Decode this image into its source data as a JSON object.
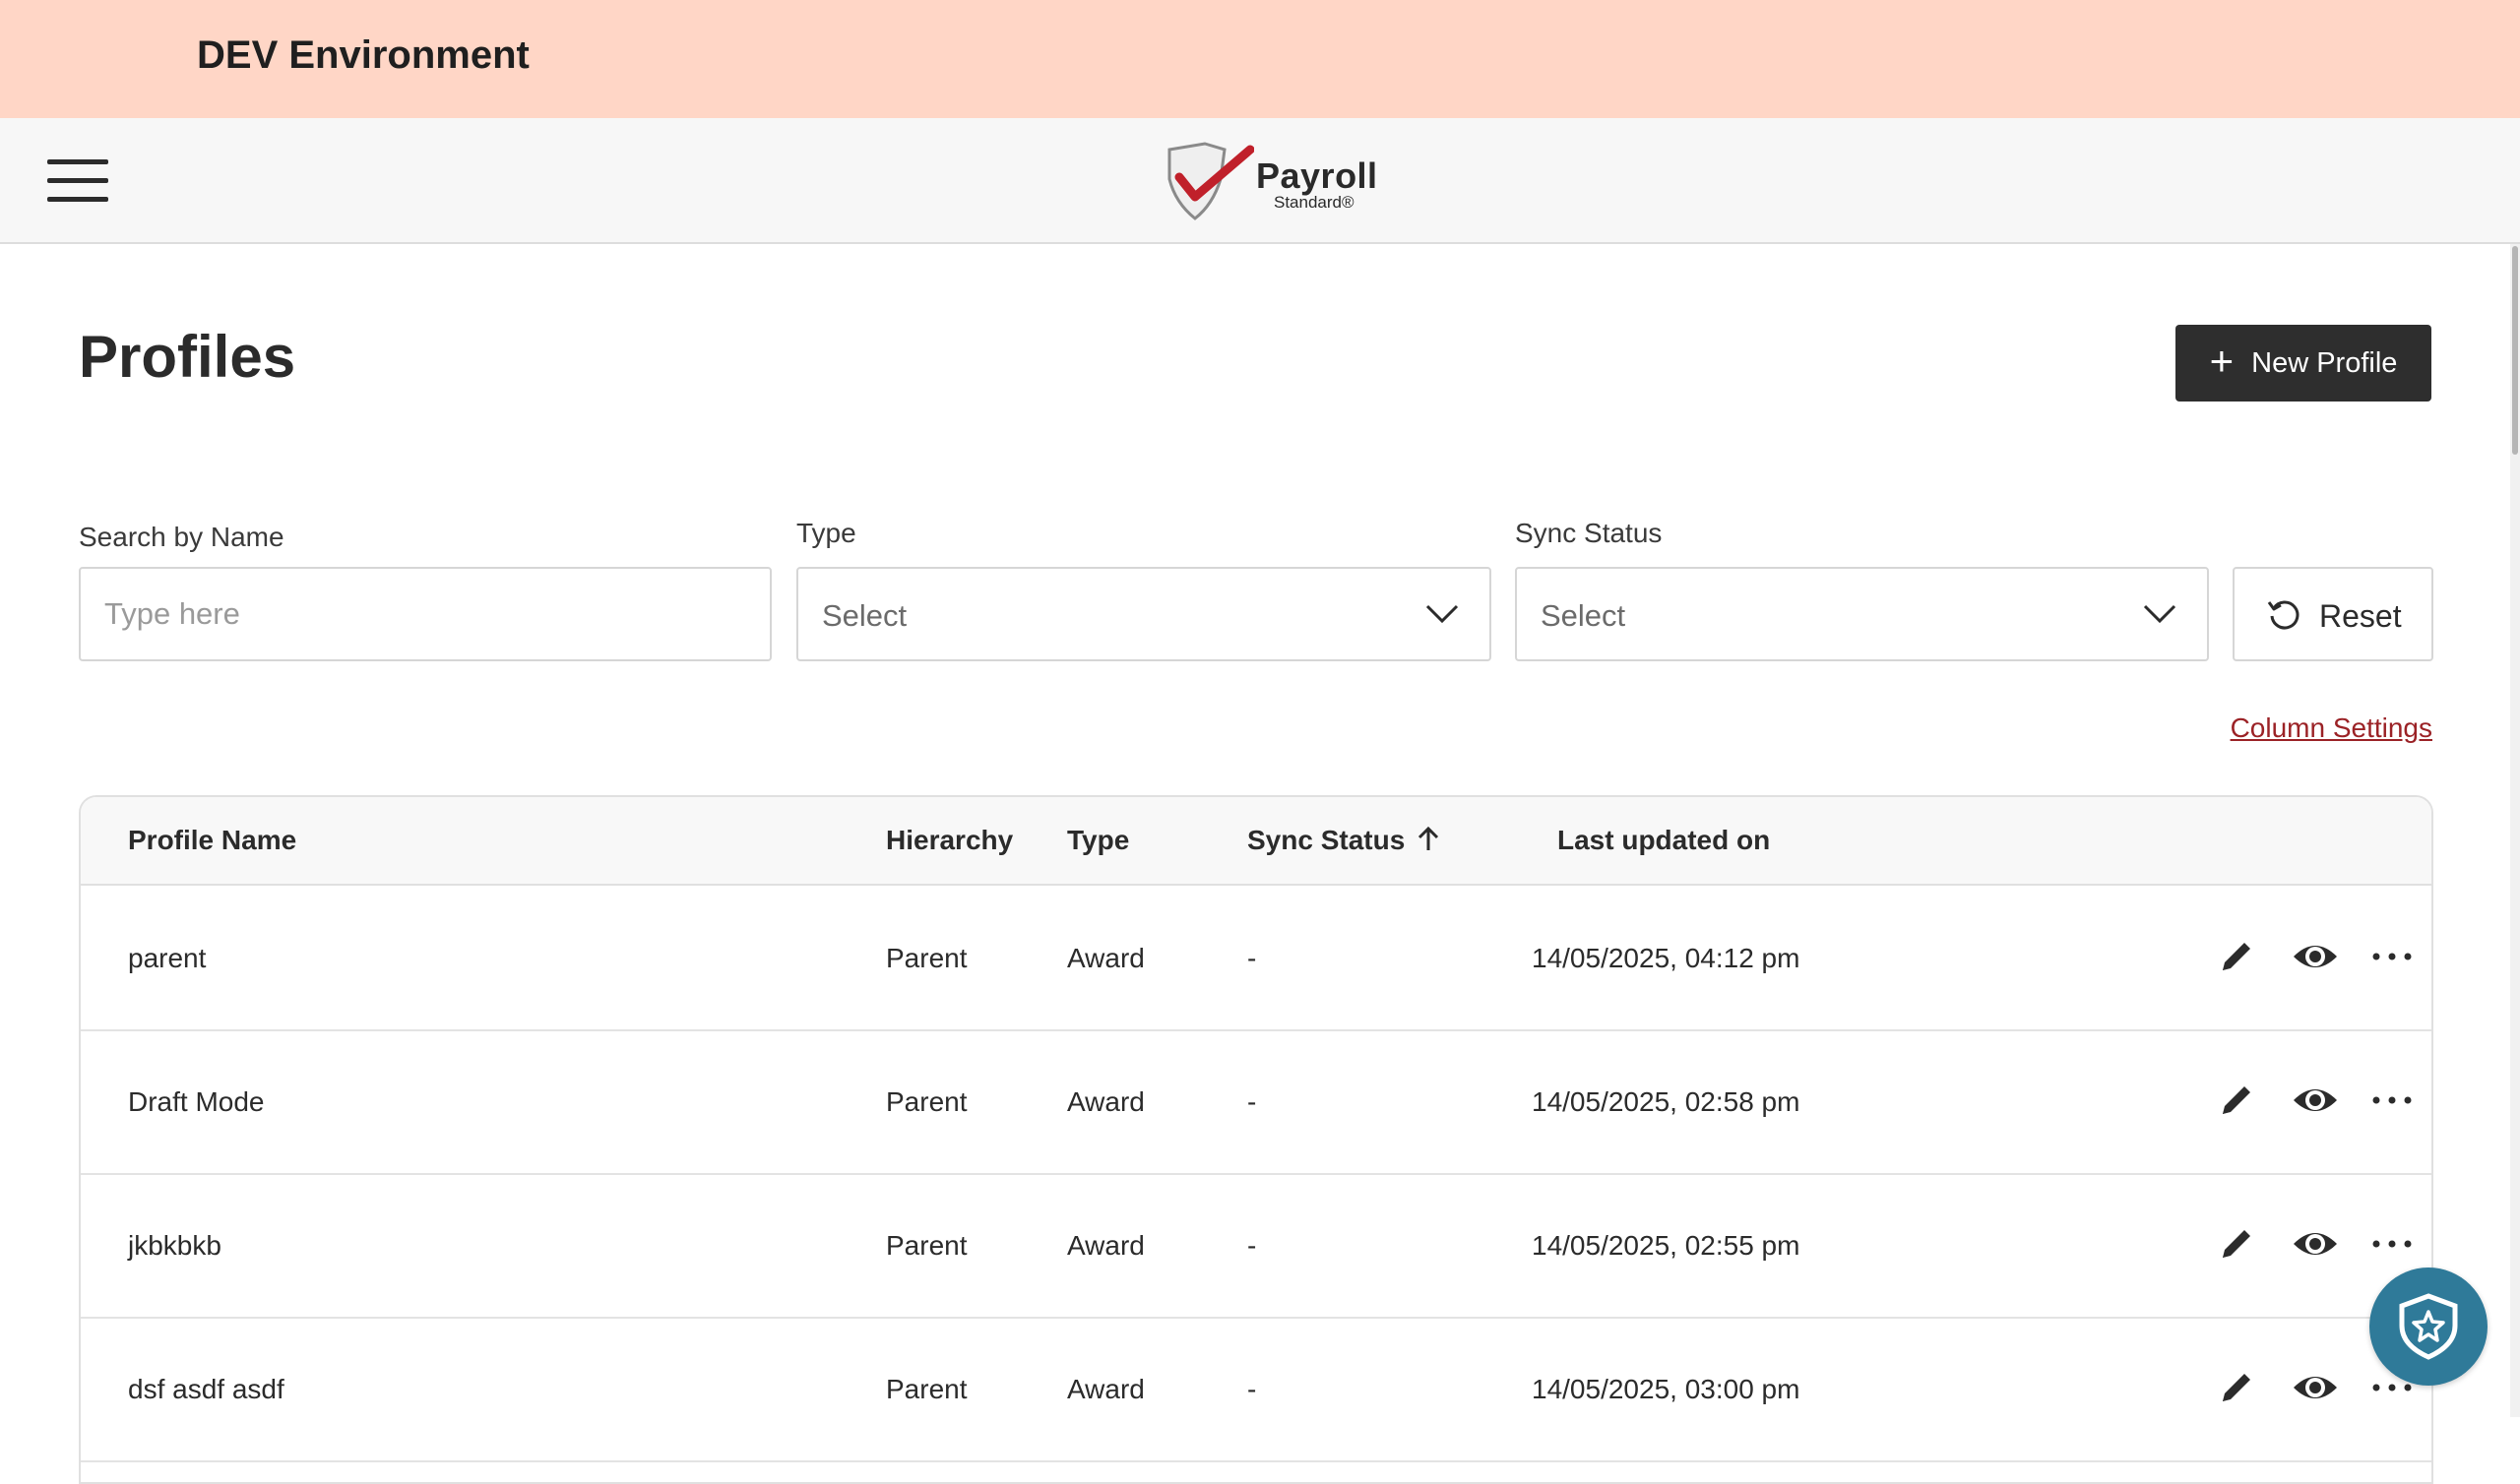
{
  "environment_banner": {
    "text": "DEV Environment"
  },
  "header": {
    "menu_icon": "hamburger-menu-icon",
    "logo": {
      "title": "Payroll",
      "subtitle": "Standard®"
    }
  },
  "page": {
    "title": "Profiles",
    "new_profile_label": "New Profile"
  },
  "filters": {
    "search": {
      "label": "Search by Name",
      "placeholder": "Type here",
      "value": ""
    },
    "type": {
      "label": "Type",
      "value": "Select"
    },
    "sync_status": {
      "label": "Sync Status",
      "value": "Select"
    },
    "reset_label": "Reset"
  },
  "column_settings_label": "Column Settings",
  "table": {
    "columns": [
      "Profile Name",
      "Hierarchy",
      "Type",
      "Sync Status",
      "Last updated on"
    ],
    "sort": {
      "column": "Sync Status",
      "direction": "ascending"
    },
    "rows": [
      {
        "name": "parent",
        "hierarchy": "Parent",
        "type": "Award",
        "sync_status": "-",
        "updated": "14/05/2025, 04:12 pm"
      },
      {
        "name": "Draft Mode",
        "hierarchy": "Parent",
        "type": "Award",
        "sync_status": "-",
        "updated": "14/05/2025, 02:58 pm"
      },
      {
        "name": "jkbkbkb",
        "hierarchy": "Parent",
        "type": "Award",
        "sync_status": "-",
        "updated": "14/05/2025, 02:55 pm"
      },
      {
        "name": "dsf asdf asdf",
        "hierarchy": "Parent",
        "type": "Award",
        "sync_status": "-",
        "updated": "14/05/2025, 03:00 pm"
      }
    ],
    "row_action_icons": [
      "edit-pencil-icon",
      "view-eye-icon",
      "more-options-icon"
    ]
  },
  "floating_button_icon": "shield-star-icon",
  "colors": {
    "banner": "#ffd6c6",
    "primary_button": "#2e2e2e",
    "link": "#9b2226",
    "fab": "#2f7a99"
  }
}
